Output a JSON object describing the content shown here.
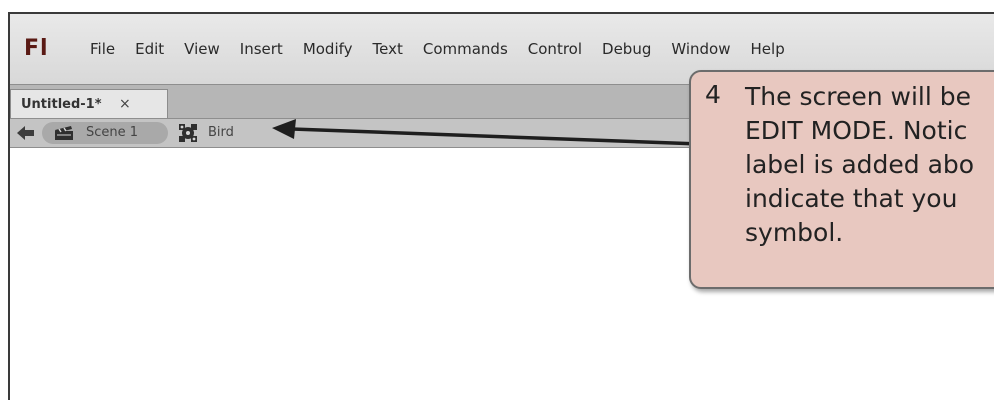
{
  "app": {
    "logo": "Fl",
    "menu": [
      "File",
      "Edit",
      "View",
      "Insert",
      "Modify",
      "Text",
      "Commands",
      "Control",
      "Debug",
      "Window",
      "Help"
    ]
  },
  "tabs": {
    "document_label": "Untitled-1*",
    "close_glyph": "×"
  },
  "edit_bar": {
    "scene_label": "Scene 1",
    "symbol_label": "Bird",
    "back_icon": "back-arrow-icon",
    "scene_icon": "clapperboard-icon",
    "symbol_icon": "movie-clip-symbol-icon"
  },
  "callout": {
    "step_number": "4",
    "lines": [
      "The screen will be",
      "EDIT MODE.  Notic",
      "label is added abo",
      "indicate that you",
      "symbol."
    ],
    "fill_color": "#e8c8c0"
  }
}
